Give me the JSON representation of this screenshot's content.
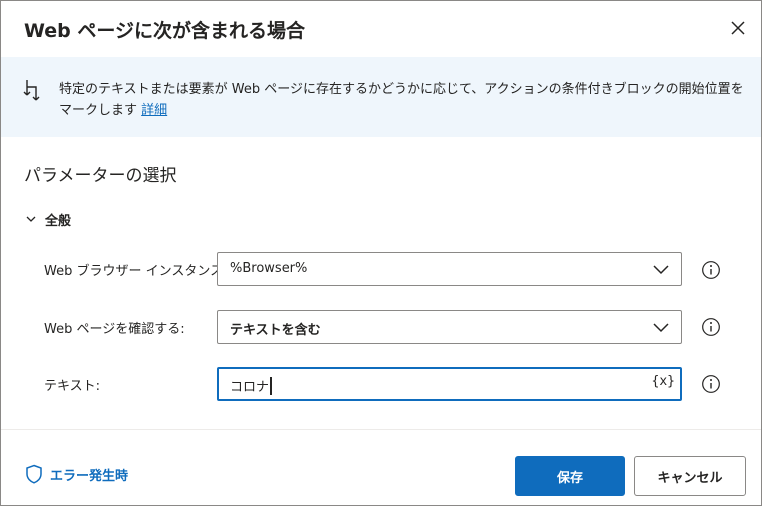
{
  "dialog": {
    "title": "Web ページに次が含まれる場合",
    "close_icon": "close-icon"
  },
  "banner": {
    "text": "特定のテキストまたは要素が Web ページに存在するかどうかに応じて、アクションの条件付きブロックの開始位置をマークします",
    "link": "詳細",
    "icon": "branch-icon"
  },
  "parameters": {
    "section_title": "パラメーターの選択",
    "group_label": "全般",
    "fields": [
      {
        "label": "Web ブラウザー インスタンス:",
        "value": "%Browser%",
        "type": "dropdown"
      },
      {
        "label": "Web ページを確認する:",
        "value": "テキストを含む",
        "type": "dropdown"
      },
      {
        "label": "テキスト:",
        "value": "コロナ",
        "type": "text",
        "variable_button": "{x}"
      }
    ]
  },
  "footer": {
    "error_link": "エラー発生時",
    "save_label": "保存",
    "cancel_label": "キャンセル"
  },
  "colors": {
    "accent": "#0f6cbd",
    "banner_bg": "#eff6fc",
    "border": "#8a8886"
  }
}
